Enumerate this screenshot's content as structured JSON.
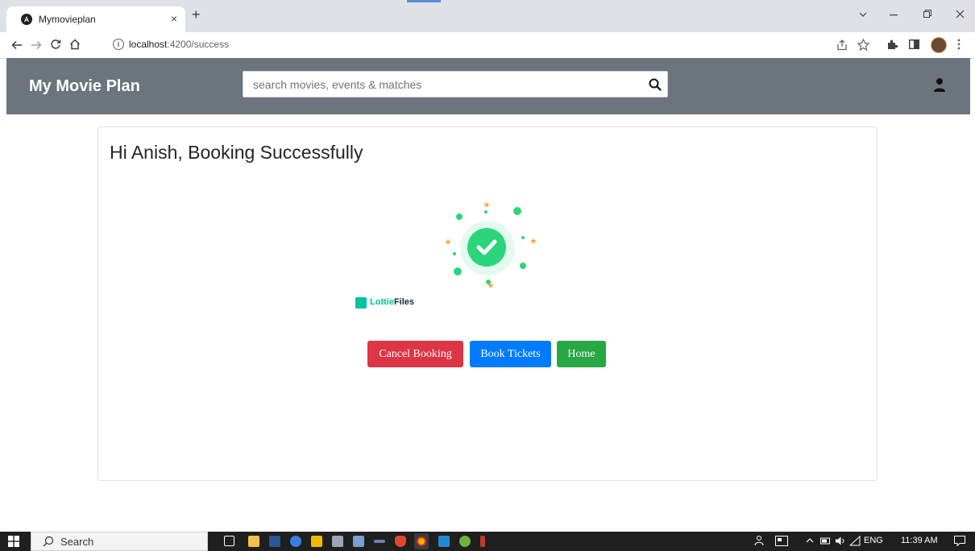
{
  "browser": {
    "tab_title": "Mymovieplan",
    "tab_close": "×",
    "new_tab": "+",
    "url_host": "localhost",
    "url_path": ":4200/success",
    "window_controls": [
      "chevron-down-icon",
      "minimize-icon",
      "restore-icon",
      "close-icon"
    ]
  },
  "app": {
    "brand": "My Movie Plan",
    "search": {
      "placeholder": "search movies, events & matches",
      "value": ""
    }
  },
  "card": {
    "title": "Hi Anish, Booking Successfully",
    "lottie_brand_a": "Lottie",
    "lottie_brand_b": "Files",
    "buttons": {
      "cancel": "Cancel Booking",
      "book": "Book Tickets",
      "home": "Home"
    }
  },
  "colors": {
    "header_bg": "#6c757d",
    "danger": "#dc3545",
    "primary": "#007bff",
    "success": "#28a745",
    "check_green": "#2bd67b"
  },
  "taskbar": {
    "search_label": "Search",
    "language": "ENG",
    "time": "11:39 AM"
  }
}
